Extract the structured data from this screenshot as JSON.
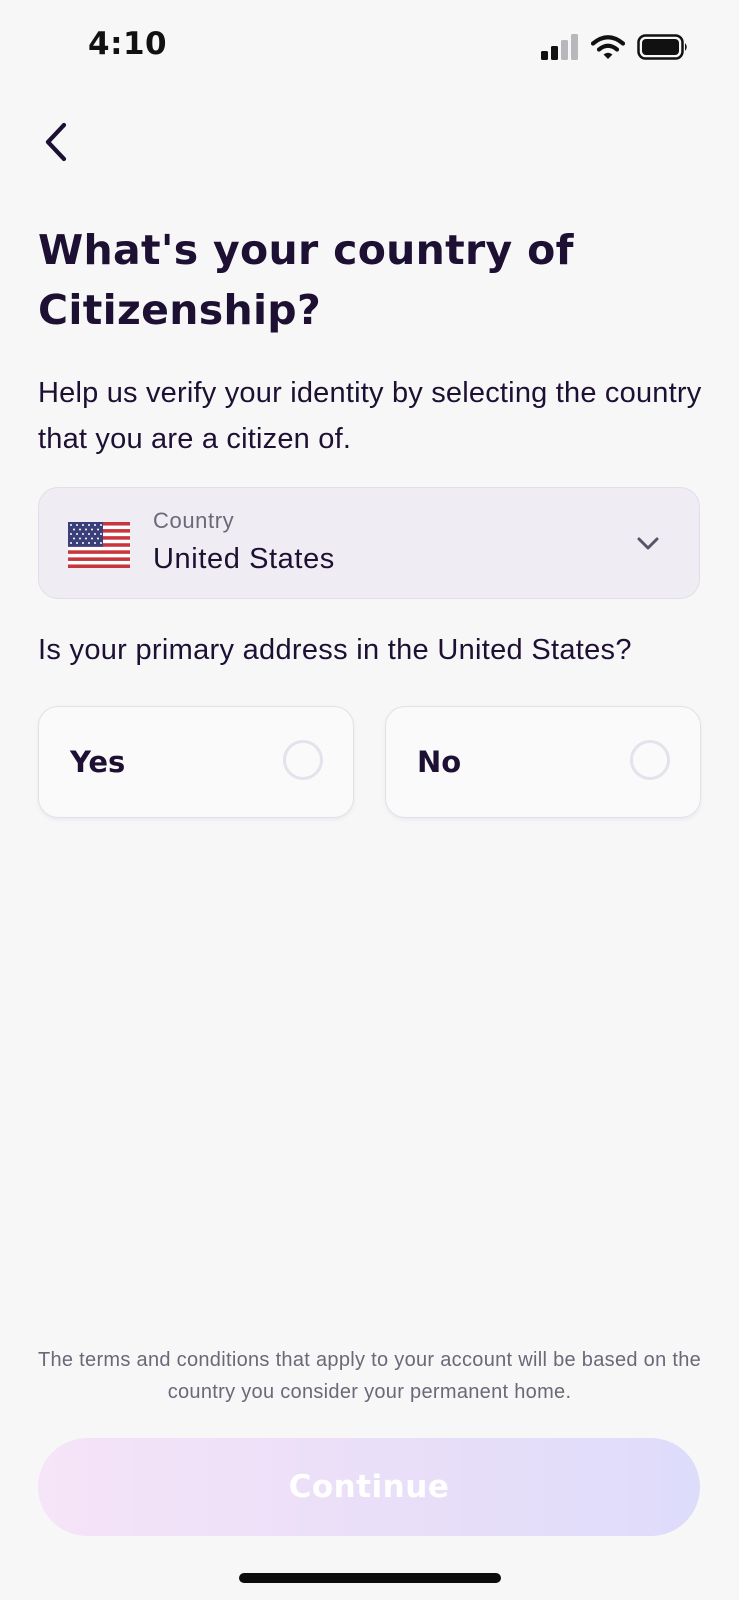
{
  "status_bar": {
    "time": "4:10"
  },
  "icons": {
    "back": "chevron-left-icon",
    "signal": "cellular-signal-icon",
    "wifi": "wifi-icon",
    "battery": "battery-icon",
    "flag": "us-flag-icon",
    "dropdown": "chevron-down-icon",
    "radio": "radio-unselected-icon"
  },
  "header": {
    "title": "What's your country of Citizenship?",
    "subtitle": "Help us verify your identity by selecting the country that you are a citizen of."
  },
  "country_select": {
    "label": "Country",
    "value": "United States"
  },
  "address_question": {
    "text": "Is your primary address in the United States?",
    "options": [
      {
        "label": "Yes",
        "selected": false
      },
      {
        "label": "No",
        "selected": false
      }
    ]
  },
  "footer": {
    "terms": "The terms and conditions that apply to your account will be based on the country you consider your permanent home.",
    "continue_label": "Continue",
    "continue_enabled": false
  },
  "colors": {
    "background": "#f7f7f8",
    "text_primary": "#1d1033",
    "text_secondary": "#6d6778",
    "select_background": "#efedf3",
    "continue_gradient_start": "#f6e4f8",
    "continue_gradient_end": "#dedcfb"
  }
}
